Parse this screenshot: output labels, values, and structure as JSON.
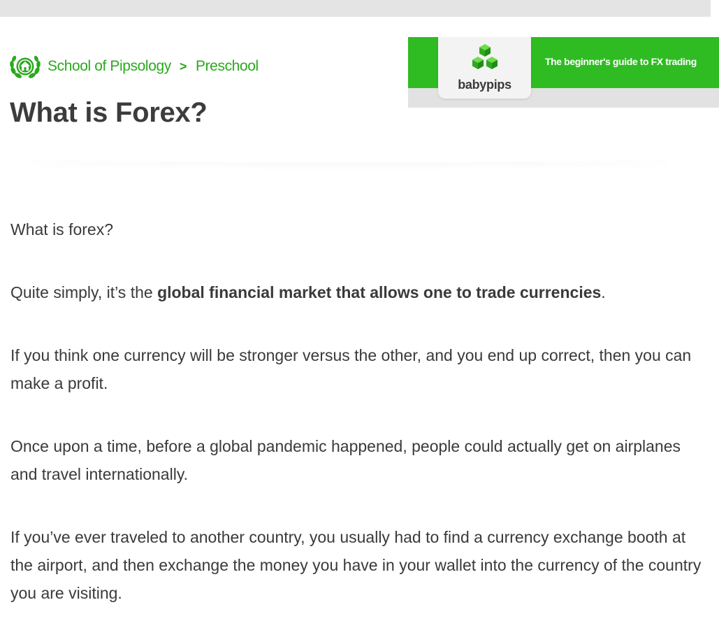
{
  "breadcrumb": {
    "root": "School of Pipsology",
    "separator": ">",
    "current": "Preschool",
    "logo_icon": "laurel-house-icon"
  },
  "page_title": "What is Forex?",
  "banner": {
    "brand": "babypips",
    "tagline": "The beginner's guide to FX trading",
    "logo_icon": "green-cubes-icon",
    "colors": {
      "green": "#2fbc22",
      "strip": "#e2e2e2"
    }
  },
  "article": {
    "p1": "What is forex?",
    "p2_prefix": "Quite simply, it’s the ",
    "p2_bold": "global financial market that allows one to trade currencies",
    "p2_suffix": ".",
    "p3": "If you think one currency will be stronger versus the other, and you end up correct, then you can make a profit.",
    "p4": "Once upon a time, before a global pandemic happened, people could actually get on airplanes and travel internationally.",
    "p5": "If you’ve ever traveled to another country, you usually had to find a currency exchange booth at the airport, and then exchange the money you have in your wallet into the currency of the country you are visiting."
  },
  "colors": {
    "accent_green": "#2aa91d",
    "text": "#3a3a3a",
    "title": "#3c3c3c"
  }
}
